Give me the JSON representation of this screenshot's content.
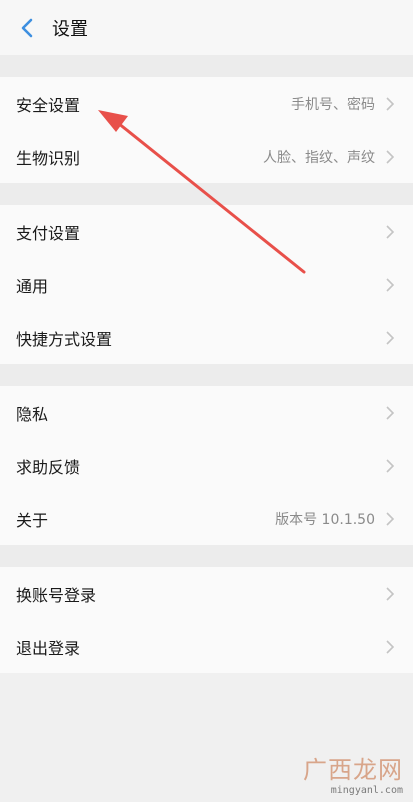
{
  "header": {
    "title": "设置"
  },
  "groups": [
    {
      "items": [
        {
          "label": "安全设置",
          "value": "手机号、密码"
        },
        {
          "label": "生物识别",
          "value": "人脸、指纹、声纹"
        }
      ]
    },
    {
      "items": [
        {
          "label": "支付设置",
          "value": ""
        },
        {
          "label": "通用",
          "value": ""
        },
        {
          "label": "快捷方式设置",
          "value": ""
        }
      ]
    },
    {
      "items": [
        {
          "label": "隐私",
          "value": ""
        },
        {
          "label": "求助反馈",
          "value": ""
        },
        {
          "label": "关于",
          "value": "版本号 10.1.50"
        }
      ]
    },
    {
      "items": [
        {
          "label": "换账号登录",
          "value": ""
        },
        {
          "label": "退出登录",
          "value": ""
        }
      ]
    }
  ],
  "watermark": {
    "brand": "广西龙网",
    "url": "mingyanl.com"
  },
  "colors": {
    "accent": "#3d8fe0",
    "annotation_arrow": "#e8504a"
  },
  "icons": {
    "back": "chevron-left-icon",
    "row": "chevron-right-icon"
  }
}
